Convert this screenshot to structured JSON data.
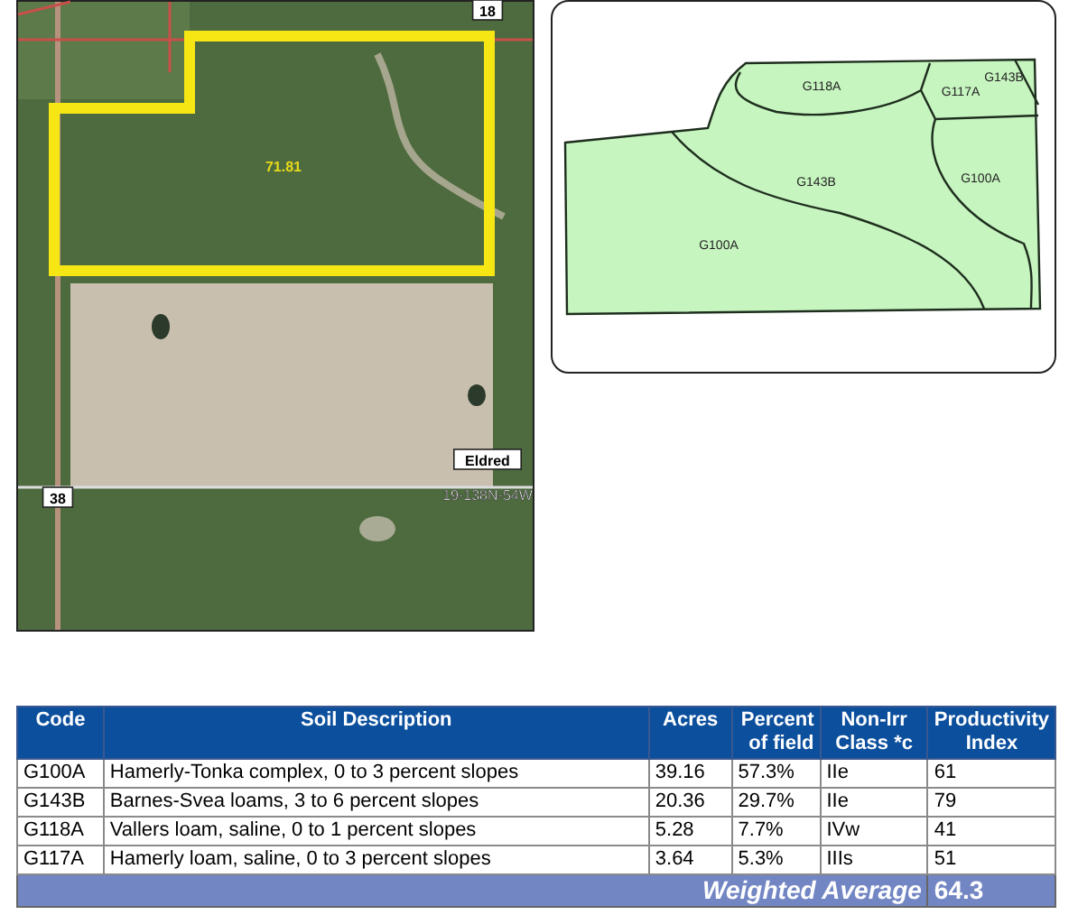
{
  "aerial_map": {
    "labels": [
      {
        "kind": "boxed",
        "text": "18"
      },
      {
        "kind": "acreage",
        "text": "71.81"
      },
      {
        "kind": "boxed",
        "text": "Eldred"
      },
      {
        "kind": "plain",
        "text": "19-138N-54W"
      },
      {
        "kind": "boxed",
        "text": "38"
      }
    ]
  },
  "soil_map": {
    "labels": [
      "G118A",
      "G117A",
      "G143B",
      "G143B",
      "G100A",
      "G100A"
    ]
  },
  "soil_table": {
    "columns": [
      "Code",
      "Soil Description",
      "Acres",
      "Percent of field",
      "Non-Irr Class *c",
      "Productivity Index"
    ],
    "rows": [
      [
        "G100A",
        "Hamerly-Tonka complex, 0 to 3 percent slopes",
        "39.16",
        "57.3%",
        "IIe",
        "61"
      ],
      [
        "G143B",
        "Barnes-Svea loams, 3 to 6 percent slopes",
        "20.36",
        "29.7%",
        "IIe",
        "79"
      ],
      [
        "G118A",
        "Vallers loam, saline, 0 to 1 percent slopes",
        "5.28",
        "7.7%",
        "IVw",
        "41"
      ],
      [
        "G117A",
        "Hamerly loam, saline, 0 to 3 percent slopes",
        "3.64",
        "5.3%",
        "IIIs",
        "51"
      ]
    ],
    "footer": {
      "label": "Weighted Average",
      "value": "64.3"
    }
  }
}
